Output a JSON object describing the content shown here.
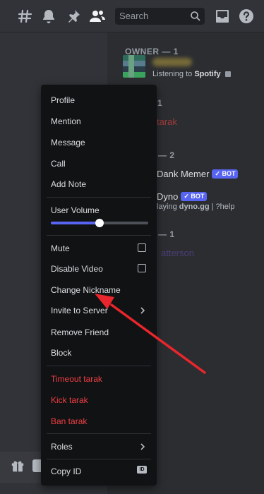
{
  "topbar": {
    "icons": [
      "threads-icon",
      "bell-icon",
      "pin-icon",
      "members-icon",
      "inbox-icon",
      "help-icon"
    ],
    "search_placeholder": "Search"
  },
  "members": {
    "owner_header": "OWNER — 1",
    "owner_activity_prefix": "Listening to ",
    "owner_activity_app": "Spotify",
    "group2_header_fragment": "1",
    "member_tarak": "tarak",
    "group3_header_fragment": "— 2",
    "dank_memer": "Dank Memer",
    "bot_label": "BOT",
    "dyno": "Dyno",
    "dyno_status_prefix": "laying ",
    "dyno_status_bold": "dyno.gg",
    "dyno_status_suffix": " | ?help",
    "group4_header_fragment": "— 1",
    "member_patterson": "atterson"
  },
  "menu": {
    "profile": "Profile",
    "mention": "Mention",
    "message": "Message",
    "call": "Call",
    "add_note": "Add Note",
    "user_volume": "User Volume",
    "volume_level": 0.5,
    "mute": "Mute",
    "disable_video": "Disable Video",
    "change_nickname": "Change Nickname",
    "invite_to_server": "Invite to Server",
    "remove_friend": "Remove Friend",
    "block": "Block",
    "timeout": "Timeout tarak",
    "kick": "Kick tarak",
    "ban": "Ban tarak",
    "roles": "Roles",
    "copy_id": "Copy ID",
    "id_badge": "ID"
  },
  "colors": {
    "background": "#313338",
    "menu_bg": "#111214",
    "danger": "#f23f43",
    "accent": "#5865f2",
    "annotation_arrow": "#e8262b",
    "tarak_name": "#a03a3a",
    "patterson_name": "#4a3f7a"
  }
}
